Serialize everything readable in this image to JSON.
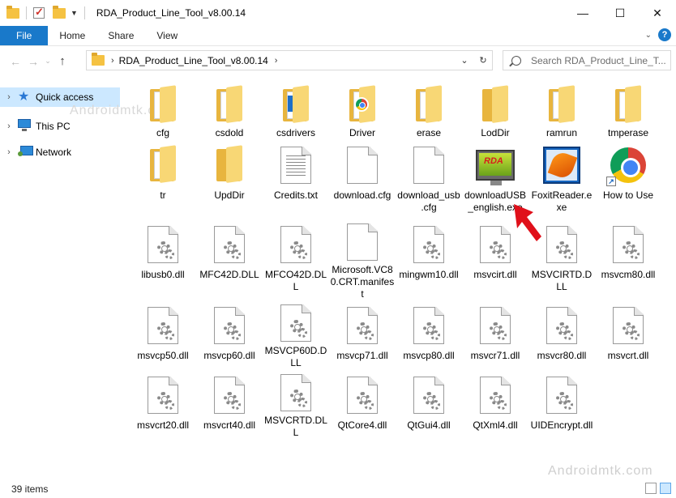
{
  "window": {
    "title": "RDA_Product_Line_Tool_v8.00.14",
    "controls": {
      "minimize": "—",
      "maximize": "☐",
      "close": "✕"
    }
  },
  "ribbon": {
    "tabs": [
      "File",
      "Home",
      "Share",
      "View"
    ]
  },
  "address": {
    "path": "RDA_Product_Line_Tool_v8.00.14",
    "search_placeholder": "Search RDA_Product_Line_T..."
  },
  "nav_pane": {
    "items": [
      {
        "label": "Quick access",
        "icon": "star-icon",
        "selected": true
      },
      {
        "label": "This PC",
        "icon": "computer-icon",
        "selected": false
      },
      {
        "label": "Network",
        "icon": "network-icon",
        "selected": false
      }
    ]
  },
  "files": [
    {
      "name": "cfg",
      "type": "folder"
    },
    {
      "name": "csdold",
      "type": "folder"
    },
    {
      "name": "csdrivers",
      "type": "folder-blue"
    },
    {
      "name": "Driver",
      "type": "folder-chrome"
    },
    {
      "name": "erase",
      "type": "folder"
    },
    {
      "name": "LodDir",
      "type": "folder-plain"
    },
    {
      "name": "ramrun",
      "type": "folder"
    },
    {
      "name": "tmperase",
      "type": "folder"
    },
    {
      "name": "tr",
      "type": "folder"
    },
    {
      "name": "UpdDir",
      "type": "folder-plain"
    },
    {
      "name": "Credits.txt",
      "type": "txt"
    },
    {
      "name": "download.cfg",
      "type": "doc"
    },
    {
      "name": "download_usb.cfg",
      "type": "doc"
    },
    {
      "name": "downloadUSB_english.exe",
      "type": "rda"
    },
    {
      "name": "FoxitReader.exe",
      "type": "foxit"
    },
    {
      "name": "How to Use",
      "type": "chrome"
    },
    {
      "name": "libusb0.dll",
      "type": "dll"
    },
    {
      "name": "MFC42D.DLL",
      "type": "dll"
    },
    {
      "name": "MFCO42D.DLL",
      "type": "dll"
    },
    {
      "name": "Microsoft.VC80.CRT.manifest",
      "type": "doc"
    },
    {
      "name": "mingwm10.dll",
      "type": "dll"
    },
    {
      "name": "msvcirt.dll",
      "type": "dll"
    },
    {
      "name": "MSVCIRTD.DLL",
      "type": "dll"
    },
    {
      "name": "msvcm80.dll",
      "type": "dll"
    },
    {
      "name": "msvcp50.dll",
      "type": "dll"
    },
    {
      "name": "msvcp60.dll",
      "type": "dll"
    },
    {
      "name": "MSVCP60D.DLL",
      "type": "dll"
    },
    {
      "name": "msvcp71.dll",
      "type": "dll"
    },
    {
      "name": "msvcp80.dll",
      "type": "dll"
    },
    {
      "name": "msvcr71.dll",
      "type": "dll"
    },
    {
      "name": "msvcr80.dll",
      "type": "dll"
    },
    {
      "name": "msvcrt.dll",
      "type": "dll"
    },
    {
      "name": "msvcrt20.dll",
      "type": "dll"
    },
    {
      "name": "msvcrt40.dll",
      "type": "dll"
    },
    {
      "name": "MSVCRTD.DLL",
      "type": "dll"
    },
    {
      "name": "QtCore4.dll",
      "type": "dll"
    },
    {
      "name": "QtGui4.dll",
      "type": "dll"
    },
    {
      "name": "QtXml4.dll",
      "type": "dll"
    },
    {
      "name": "UIDEncrypt.dll",
      "type": "dll"
    }
  ],
  "status": {
    "items_count": "39 items"
  },
  "watermark": {
    "text": "Androidmtk.com"
  },
  "colors": {
    "file_tab": "#1979ca",
    "selection": "#cce8ff",
    "arrow": "#e0101a"
  }
}
